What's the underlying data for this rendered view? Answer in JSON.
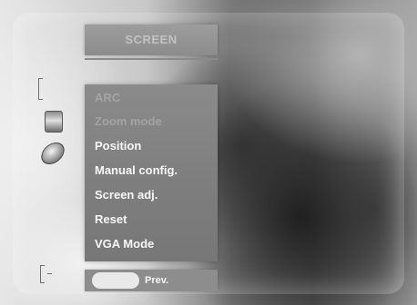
{
  "menu": {
    "title": "SCREEN",
    "items": [
      {
        "label": "ARC",
        "state": "disabled"
      },
      {
        "label": "Zoom mode",
        "state": "disabled"
      },
      {
        "label": "Position",
        "state": "enabled"
      },
      {
        "label": "Manual config.",
        "state": "enabled"
      },
      {
        "label": "Screen adj.",
        "state": "enabled"
      },
      {
        "label": "Reset",
        "state": "enabled"
      },
      {
        "label": "VGA Mode",
        "state": "enabled"
      }
    ]
  },
  "footer": {
    "prev_label": "Prev."
  },
  "icons": [
    "bracket-icon",
    "screen-icon",
    "disc-icon",
    "bracket-icon"
  ],
  "colors": {
    "panel": "#8b8b8b",
    "text": "#f7f7f7",
    "dim_text": "#a3a3a3",
    "pill": "#e9e9e9"
  }
}
